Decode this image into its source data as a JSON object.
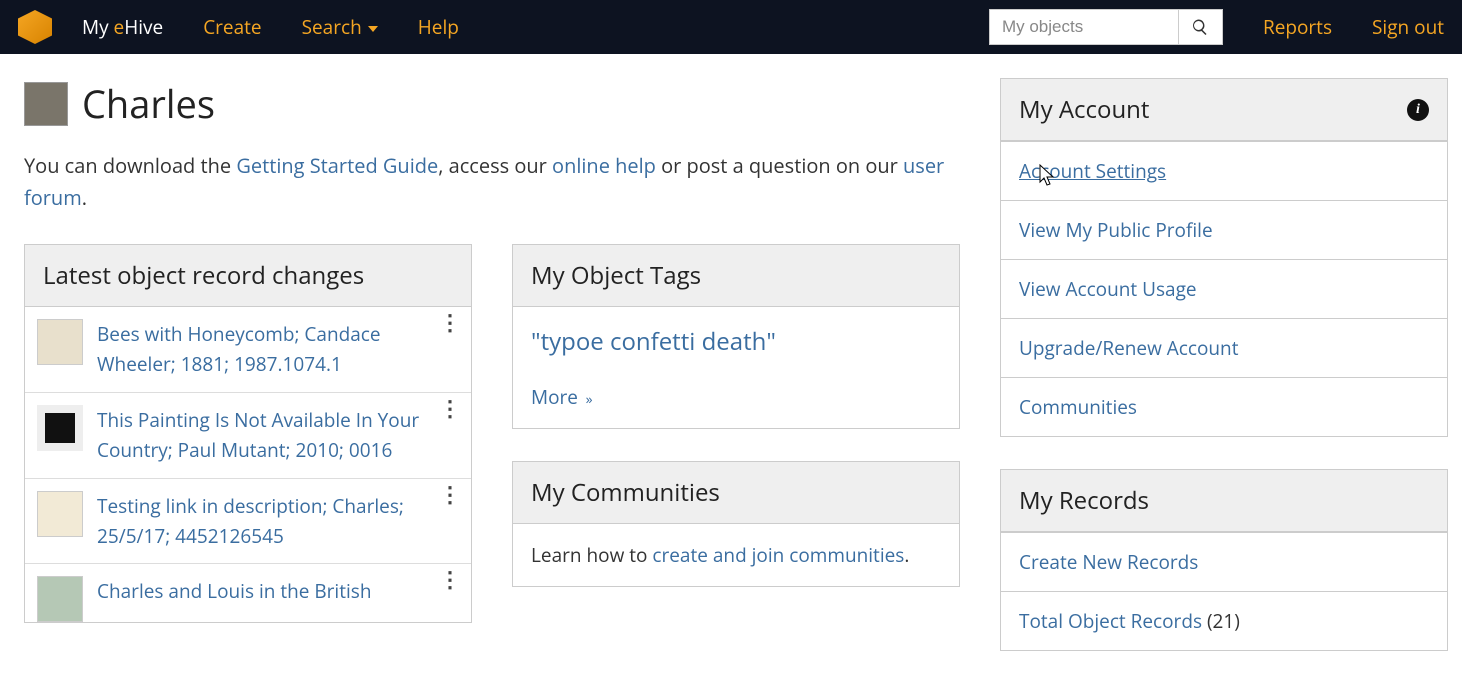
{
  "nav": {
    "home_prefix": "My ",
    "home_e": "e",
    "home_suffix": "Hive",
    "create": "Create",
    "search": "Search",
    "help": "Help",
    "search_placeholder": "My objects",
    "reports": "Reports",
    "signout": "Sign out"
  },
  "page": {
    "title": "Charles",
    "intro_a": "You can download the ",
    "intro_link1": "Getting Started Guide",
    "intro_b": ", access our ",
    "intro_link2": "online help",
    "intro_c": " or post a question on our ",
    "intro_link3": "user forum",
    "intro_d": "."
  },
  "latest": {
    "heading": "Latest object record changes",
    "items": [
      "Bees with Honeycomb; Candace Wheeler; 1881; 1987.1074.1",
      "This Painting Is Not Available In Your Country; Paul Mutant; 2010; 0016",
      "Testing link in description; Charles; 25/5/17; 4452126545",
      "Charles and Louis in the British"
    ]
  },
  "tags": {
    "heading": "My Object Tags",
    "tag": "\"typoe confetti death\"",
    "more": "More"
  },
  "communities": {
    "heading": "My Communities",
    "text_a": "Learn how to ",
    "text_link": "create and join communities",
    "text_b": "."
  },
  "account": {
    "heading": "My Account",
    "items": [
      "Account Settings",
      "View My Public Profile",
      "View Account Usage",
      "Upgrade/Renew Account",
      "Communities"
    ]
  },
  "records": {
    "heading": "My Records",
    "create": "Create New Records",
    "total_label": "Total Object Records",
    "total_count": "(21)"
  }
}
